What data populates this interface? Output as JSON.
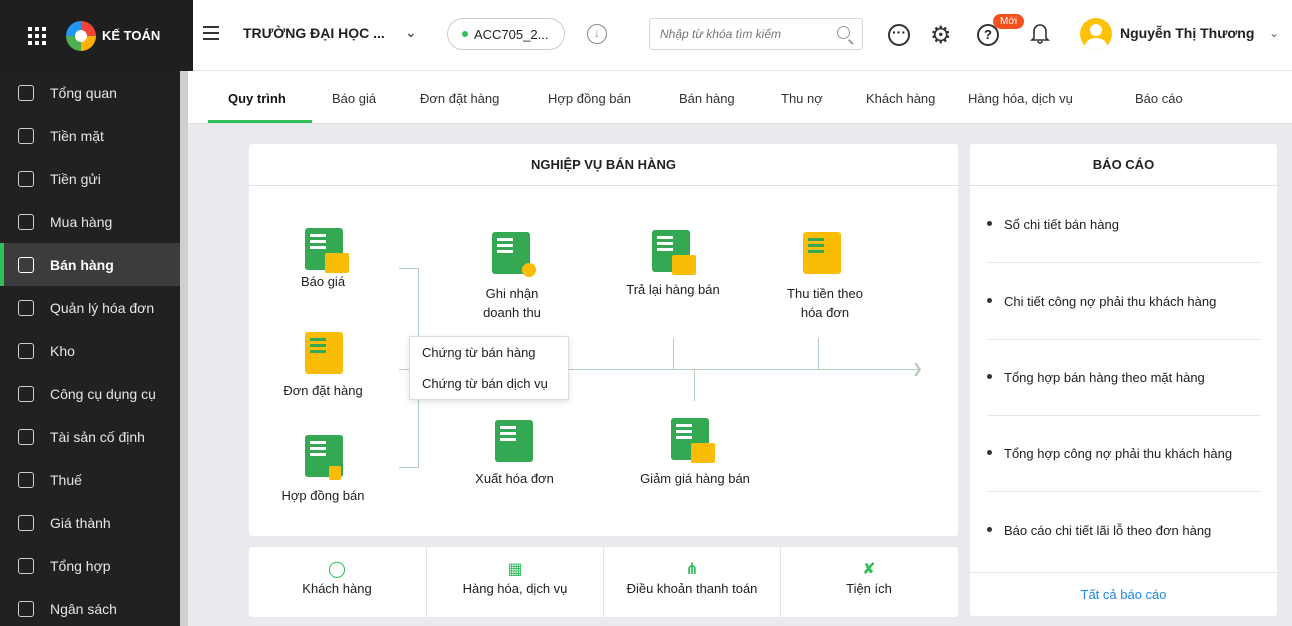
{
  "brand": {
    "app_name": "KẾ TOÁN"
  },
  "header": {
    "org_name": "TRƯỜNG ĐẠI HỌC ...",
    "account": "ACC705_2...",
    "search_placeholder": "Nhập từ khóa tìm kiếm",
    "new_badge": "Mới",
    "user_name": "Nguyễn Thị Thương"
  },
  "sidebar": {
    "items": [
      {
        "label": "Tổng quan"
      },
      {
        "label": "Tiền mặt"
      },
      {
        "label": "Tiền gửi"
      },
      {
        "label": "Mua hàng"
      },
      {
        "label": "Bán hàng"
      },
      {
        "label": "Quản lý hóa đơn"
      },
      {
        "label": "Kho"
      },
      {
        "label": "Công cụ dụng cụ"
      },
      {
        "label": "Tài sản cố định"
      },
      {
        "label": "Thuế"
      },
      {
        "label": "Giá thành"
      },
      {
        "label": "Tổng hợp"
      },
      {
        "label": "Ngân sách"
      }
    ]
  },
  "tabs": [
    {
      "label": "Quy trình"
    },
    {
      "label": "Báo giá"
    },
    {
      "label": "Đơn đặt hàng"
    },
    {
      "label": "Hợp đồng bán"
    },
    {
      "label": "Bán hàng"
    },
    {
      "label": "Thu nợ"
    },
    {
      "label": "Khách hàng"
    },
    {
      "label": "Hàng hóa, dịch vụ"
    },
    {
      "label": "Báo cáo"
    }
  ],
  "process": {
    "title": "NGHIỆP VỤ BÁN HÀNG",
    "steps": {
      "quote": "Báo giá",
      "order": "Đơn đặt hàng",
      "contract": "Hợp đồng bán",
      "revenue_line1": "Ghi nhận",
      "revenue_line2": "doanh thu",
      "return": "Trả lại hàng bán",
      "collect_line1": "Thu tiền theo",
      "collect_line2": "hóa đơn",
      "invoice": "Xuất hóa đơn",
      "discount": "Giảm giá hàng bán"
    },
    "popup": [
      "Chứng từ bán hàng",
      "Chứng từ bán dịch vụ"
    ]
  },
  "utilities": [
    {
      "label": "Khách hàng"
    },
    {
      "label": "Hàng hóa, dịch vụ"
    },
    {
      "label": "Điều khoản thanh toán"
    },
    {
      "label": "Tiện ích"
    }
  ],
  "reports": {
    "title": "BÁO CÁO",
    "items": [
      "Sổ chi tiết bán hàng",
      "Chi tiết công nợ phải thu khách hàng",
      "Tổng hợp bán hàng theo mặt hàng",
      "Tổng hợp công nợ phải thu khách hàng",
      "Báo cáo chi tiết lãi lỗ theo đơn hàng"
    ],
    "all_link": "Tất cả báo cáo"
  }
}
